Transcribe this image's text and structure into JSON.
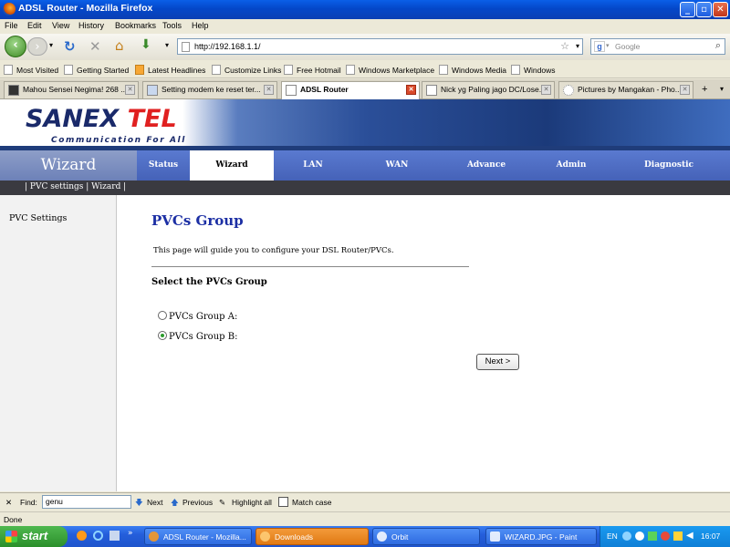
{
  "window": {
    "title": "ADSL Router - Mozilla Firefox"
  },
  "menu": [
    "File",
    "Edit",
    "View",
    "History",
    "Bookmarks",
    "Tools",
    "Help"
  ],
  "nav": {
    "url": "http://192.168.1.1/",
    "search_placeholder": "Google"
  },
  "bookmarks": [
    "Most Visited",
    "Getting Started",
    "Latest Headlines",
    "Customize Links",
    "Free Hotmail",
    "Windows Marketplace",
    "Windows Media",
    "Windows"
  ],
  "tabs": [
    {
      "label": "Mahou Sensei Negima! 268 ...",
      "active": false
    },
    {
      "label": "Setting modem ke reset ter...",
      "active": false
    },
    {
      "label": "ADSL Router",
      "active": true
    },
    {
      "label": "Nick yg Paling jago DC/Lose...",
      "active": false
    },
    {
      "label": "Pictures by Mangakan - Pho...",
      "active": false
    }
  ],
  "router": {
    "logo": {
      "brand": "SANEX",
      "tel": "TEL",
      "tagline": "Communication For All"
    },
    "section_title": "Wizard",
    "nav": [
      "Status",
      "Wizard",
      "LAN",
      "WAN",
      "Advance",
      "Admin",
      "Diagnostic"
    ],
    "active_nav": "Wizard",
    "subnav": "| PVC settings | Wizard |",
    "sidebar": [
      "PVC Settings"
    ],
    "page_title": "PVCs Group",
    "description": "This page will guide you to configure your DSL Router/PVCs.",
    "select_label": "Select the PVCs Group",
    "options": [
      {
        "label": "PVCs Group A:",
        "selected": false
      },
      {
        "label": "PVCs Group B:",
        "selected": true
      }
    ],
    "next_label": "Next >"
  },
  "findbar": {
    "label": "Find:",
    "value": "genu",
    "next": "Next",
    "previous": "Previous",
    "highlight": "Highlight all",
    "match_case": "Match case"
  },
  "status": "Done",
  "taskbar": {
    "start": "start",
    "tasks": [
      "ADSL Router - Mozilla...",
      "Downloads",
      "Orbit",
      "WIZARD.JPG - Paint"
    ],
    "lang": "EN",
    "clock": "16:07"
  },
  "colors": {
    "title_blue": "#1c2fa4",
    "nav_blue": "#4562b8",
    "subnav_dark": "#3a3a40",
    "logo_red": "#e02020"
  }
}
